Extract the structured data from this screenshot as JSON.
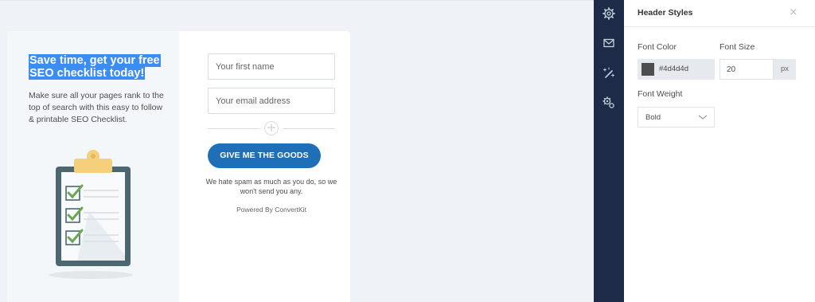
{
  "form": {
    "headline": "Save time, get your free SEO checklist today!",
    "description": "Make sure all your pages rank to the top of search with this easy to follow & printable SEO Checklist.",
    "first_name_placeholder": "Your first name",
    "email_placeholder": "Your email address",
    "divider_icon": "+",
    "cta_label": "GIVE ME THE GOODS",
    "spam_note": "We hate spam as much as you do, so we won't send you any.",
    "powered_by": "Powered By ConvertKit",
    "illustration": "clipboard-checklist-icon"
  },
  "sidebar": {
    "icons": [
      "gear-icon",
      "envelope-icon",
      "magic-wand-icon",
      "gears-icon"
    ]
  },
  "panel": {
    "title": "Header Styles",
    "close_icon": "×",
    "font_color_label": "Font Color",
    "font_color_value": "#4d4d4d",
    "font_size_label": "Font Size",
    "font_size_value": "20",
    "font_size_unit": "px",
    "font_weight_label": "Font Weight",
    "font_weight_value": "Bold"
  },
  "colors": {
    "cta": "#1f6fb8",
    "sidebar": "#1d2b48",
    "highlight": "#3b8cf3",
    "check": "#6aa84f"
  }
}
